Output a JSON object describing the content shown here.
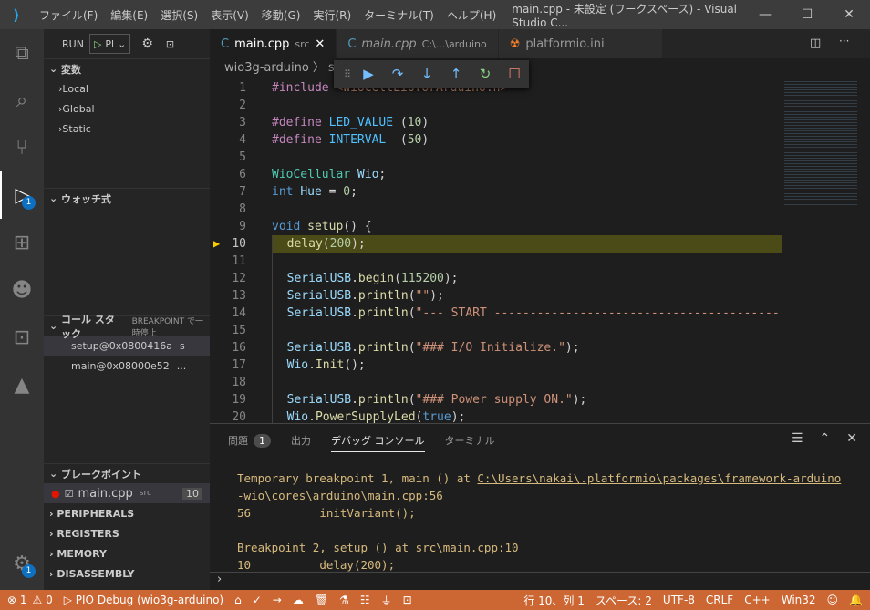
{
  "title": {
    "menus": [
      "ファイル(F)",
      "編集(E)",
      "選択(S)",
      "表示(V)",
      "移動(G)",
      "実行(R)",
      "ターミナル(T)",
      "ヘルプ(H)"
    ],
    "window": "main.cpp - 未設定 (ワークスペース) - Visual Studio C..."
  },
  "activity": {
    "debug_badge": "1",
    "settings_badge": "1"
  },
  "sidebar": {
    "run_label": "RUN",
    "config": "Pl",
    "variables": "変数",
    "scopes": [
      "Local",
      "Global",
      "Static"
    ],
    "watch": "ウォッチ式",
    "callstack": "コール スタック",
    "callstack_status": "BREAKPOINT で一時停止",
    "frames": [
      {
        "name": "setup@0x0800416a",
        "extra": "s"
      },
      {
        "name": "main@0x08000e52",
        "extra": "..."
      }
    ],
    "breakpoints": "ブレークポイント",
    "bp_file": "main.cpp",
    "bp_dir": "src",
    "bp_line": "10",
    "sections": [
      "PERIPHERALS",
      "REGISTERS",
      "MEMORY",
      "DISASSEMBLY"
    ]
  },
  "tabs": [
    {
      "label": "main.cpp",
      "desc": "src"
    },
    {
      "label": "main.cpp",
      "desc": "C:\\...\\arduino"
    },
    {
      "label": "platformio.ini",
      "desc": ""
    }
  ],
  "breadcrumb": "wio3g-arduino 〉 src",
  "code": [
    [
      [
        "#include ",
        "p"
      ],
      [
        "<WioCellLibforArduino.h>",
        "s"
      ]
    ],
    [],
    [
      [
        "#define ",
        "p"
      ],
      [
        "LED_VALUE ",
        "m"
      ],
      [
        "(",
        "o"
      ],
      [
        "10",
        "n"
      ],
      [
        ")",
        "o"
      ]
    ],
    [
      [
        "#define ",
        "p"
      ],
      [
        "INTERVAL  ",
        "m"
      ],
      [
        "(",
        "o"
      ],
      [
        "50",
        "n"
      ],
      [
        ")",
        "o"
      ]
    ],
    [],
    [
      [
        "WioCellular ",
        "t"
      ],
      [
        "Wio",
        "v"
      ],
      [
        ";",
        "o"
      ]
    ],
    [
      [
        "int ",
        "k"
      ],
      [
        "Hue",
        "v"
      ],
      [
        " = ",
        "o"
      ],
      [
        "0",
        "n"
      ],
      [
        ";",
        "o"
      ]
    ],
    [],
    [
      [
        "void ",
        "k"
      ],
      [
        "setup",
        "f"
      ],
      [
        "() {",
        "o"
      ]
    ],
    [
      [
        "  delay",
        "f"
      ],
      [
        "(",
        "o"
      ],
      [
        "200",
        "n"
      ],
      [
        ");",
        "o"
      ]
    ],
    [],
    [
      [
        "  SerialUSB",
        "v"
      ],
      [
        ".",
        "o"
      ],
      [
        "begin",
        "f"
      ],
      [
        "(",
        "o"
      ],
      [
        "115200",
        "n"
      ],
      [
        ");",
        "o"
      ]
    ],
    [
      [
        "  SerialUSB",
        "v"
      ],
      [
        ".",
        "o"
      ],
      [
        "println",
        "f"
      ],
      [
        "(",
        "o"
      ],
      [
        "\"\"",
        "s"
      ],
      [
        ");",
        "o"
      ]
    ],
    [
      [
        "  SerialUSB",
        "v"
      ],
      [
        ".",
        "o"
      ],
      [
        "println",
        "f"
      ],
      [
        "(",
        "o"
      ],
      [
        "\"--- START ---------------------------------------------",
        "s"
      ]
    ],
    [],
    [
      [
        "  SerialUSB",
        "v"
      ],
      [
        ".",
        "o"
      ],
      [
        "println",
        "f"
      ],
      [
        "(",
        "o"
      ],
      [
        "\"### I/O Initialize.\"",
        "s"
      ],
      [
        ");",
        "o"
      ]
    ],
    [
      [
        "  Wio",
        "v"
      ],
      [
        ".",
        "o"
      ],
      [
        "Init",
        "f"
      ],
      [
        "();",
        "o"
      ]
    ],
    [],
    [
      [
        "  SerialUSB",
        "v"
      ],
      [
        ".",
        "o"
      ],
      [
        "println",
        "f"
      ],
      [
        "(",
        "o"
      ],
      [
        "\"### Power supply ON.\"",
        "s"
      ],
      [
        ");",
        "o"
      ]
    ],
    [
      [
        "  Wio",
        "v"
      ],
      [
        ".",
        "o"
      ],
      [
        "PowerSupplyLed",
        "f"
      ],
      [
        "(",
        "o"
      ],
      [
        "true",
        "k"
      ],
      [
        ");",
        "o"
      ]
    ]
  ],
  "current_line": 10,
  "panel": {
    "tabs": [
      "問題",
      "出力",
      "デバッグ コンソール",
      "ターミナル"
    ],
    "problems_count": "1",
    "out1": "Temporary breakpoint 1, main () at ",
    "link1": "C:\\Users\\nakai\\.platformio\\packages\\framework-arduino",
    "link2": "-wio\\cores\\arduino\\main.cpp:56",
    "out2": "56\t    initVariant();",
    "out3": "Breakpoint 2, setup () at src\\main.cpp:10",
    "out4": "10\t    delay(200);",
    "prompt": "›"
  },
  "status": {
    "errors": "⊗ 1",
    "warnings": "⚠ 0",
    "debug": "▷ PIO Debug (wio3g-arduino)",
    "position": "行 10、列 1",
    "spaces": "スペース: 2",
    "encoding": "UTF-8",
    "eol": "CRLF",
    "language": "C++",
    "platform": "Win32",
    "color": "#cc6633"
  }
}
